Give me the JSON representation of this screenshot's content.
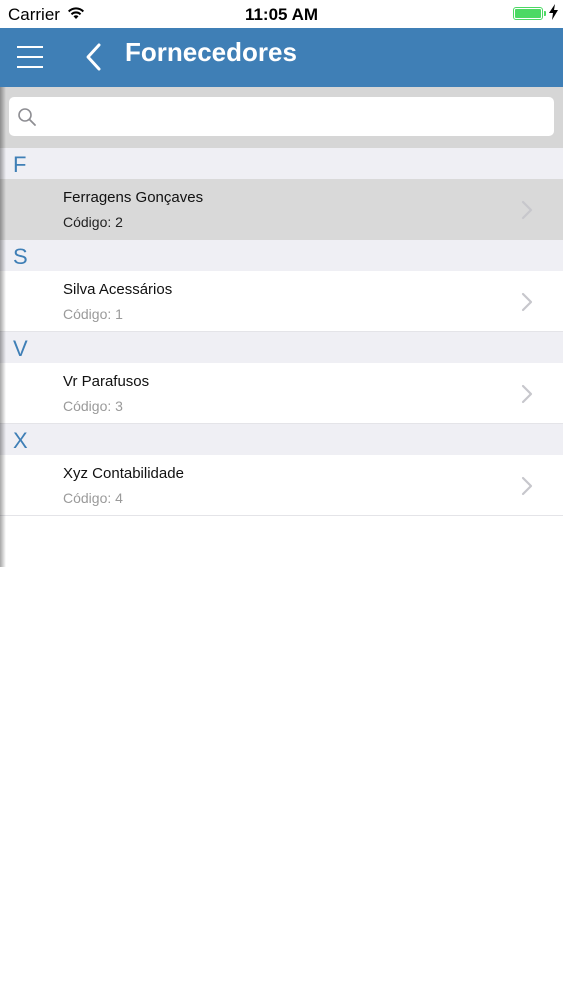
{
  "status_bar": {
    "carrier": "Carrier",
    "time": "11:05 AM",
    "battery_level": 1.0,
    "battery_color": "#4cd964"
  },
  "nav_bar": {
    "title": "Fornecedores",
    "menu_icon": "hamburger-menu-icon",
    "back_icon": "chevron-left-icon",
    "background_color": "#3f7fb6"
  },
  "search": {
    "value": "",
    "placeholder": "",
    "icon": "search-icon"
  },
  "accent_color": "#3f7fb6",
  "sections": [
    {
      "letter": "F",
      "items": [
        {
          "name": "Ferragens Gonçaves",
          "code": "Código: 2",
          "selected": true
        }
      ]
    },
    {
      "letter": "S",
      "items": [
        {
          "name": "Silva Acessários",
          "code": "Código: 1",
          "selected": false
        }
      ]
    },
    {
      "letter": "V",
      "items": [
        {
          "name": "Vr Parafusos",
          "code": "Código: 3",
          "selected": false
        }
      ]
    },
    {
      "letter": "X",
      "items": [
        {
          "name": "Xyz Contabilidade",
          "code": "Código: 4",
          "selected": false
        }
      ]
    }
  ]
}
